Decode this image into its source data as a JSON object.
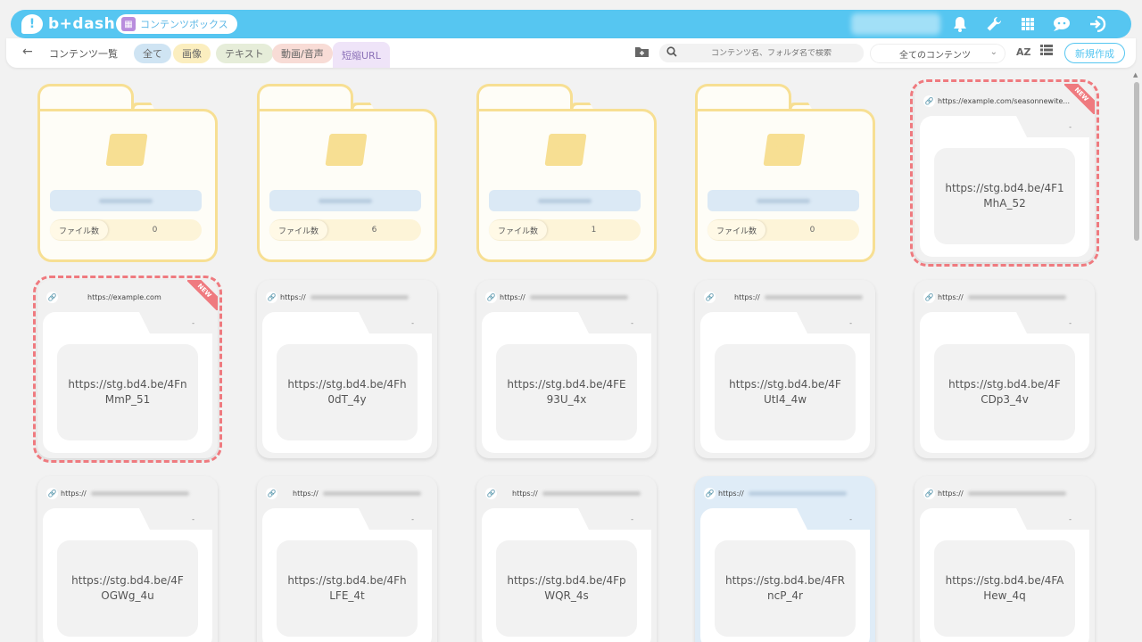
{
  "header": {
    "logo_mark": "!",
    "logo_text": "b+dash",
    "content_box_label": "コンテンツボックス",
    "icons": [
      "bell-icon",
      "wrench-icon",
      "grid-icon",
      "chat-icon",
      "logout-icon"
    ],
    "accent_color": "#56c6f1"
  },
  "filterbar": {
    "back": "←",
    "title": "コンテンツ一覧",
    "chips": {
      "all": "全て",
      "image": "画像",
      "text": "テキスト",
      "video": "動画/音声",
      "url": "短縮URL"
    },
    "search_placeholder": "コンテンツ名、フォルダ名で検索",
    "select_value": "全てのコンテンツ",
    "sort_label": "AZ",
    "new_button": "新規作成"
  },
  "folders": [
    {
      "count_label": "ファイル数",
      "count": "0"
    },
    {
      "count_label": "ファイル数",
      "count": "6"
    },
    {
      "count_label": "ファイル数",
      "count": "1"
    },
    {
      "count_label": "ファイル数",
      "count": "0"
    }
  ],
  "url_cards": [
    {
      "source": "https://example.com/seasonnewite...",
      "dash": "-",
      "short": "https://stg.bd4.be/4F1MhA_52",
      "badge": "NEW"
    },
    {
      "source": "https://example.com",
      "dash": "-",
      "short": "https://stg.bd4.be/4FnMmP_51",
      "badge": "NEW"
    },
    {
      "source": "https://",
      "dash": "-",
      "short": "https://stg.bd4.be/4Fh0dT_4y"
    },
    {
      "source": "https://",
      "dash": "-",
      "short": "https://stg.bd4.be/4FE93U_4x"
    },
    {
      "source": "https://",
      "dash": "-",
      "short": "https://stg.bd4.be/4FUtI4_4w"
    },
    {
      "source": "https://",
      "dash": "-",
      "short": "https://stg.bd4.be/4FCDp3_4v"
    },
    {
      "source": "https://",
      "dash": "-",
      "short": "https://stg.bd4.be/4FOGWg_4u"
    },
    {
      "source": "https://",
      "dash": "-",
      "short": "https://stg.bd4.be/4FhLFE_4t"
    },
    {
      "source": "https://",
      "dash": "-",
      "short": "https://stg.bd4.be/4FpWQR_4s"
    },
    {
      "source": "https://",
      "dash": "-",
      "short": "https://stg.bd4.be/4FRncP_4r"
    },
    {
      "source": "https://",
      "dash": "-",
      "short": "https://stg.bd4.be/4FAHew_4q"
    }
  ]
}
